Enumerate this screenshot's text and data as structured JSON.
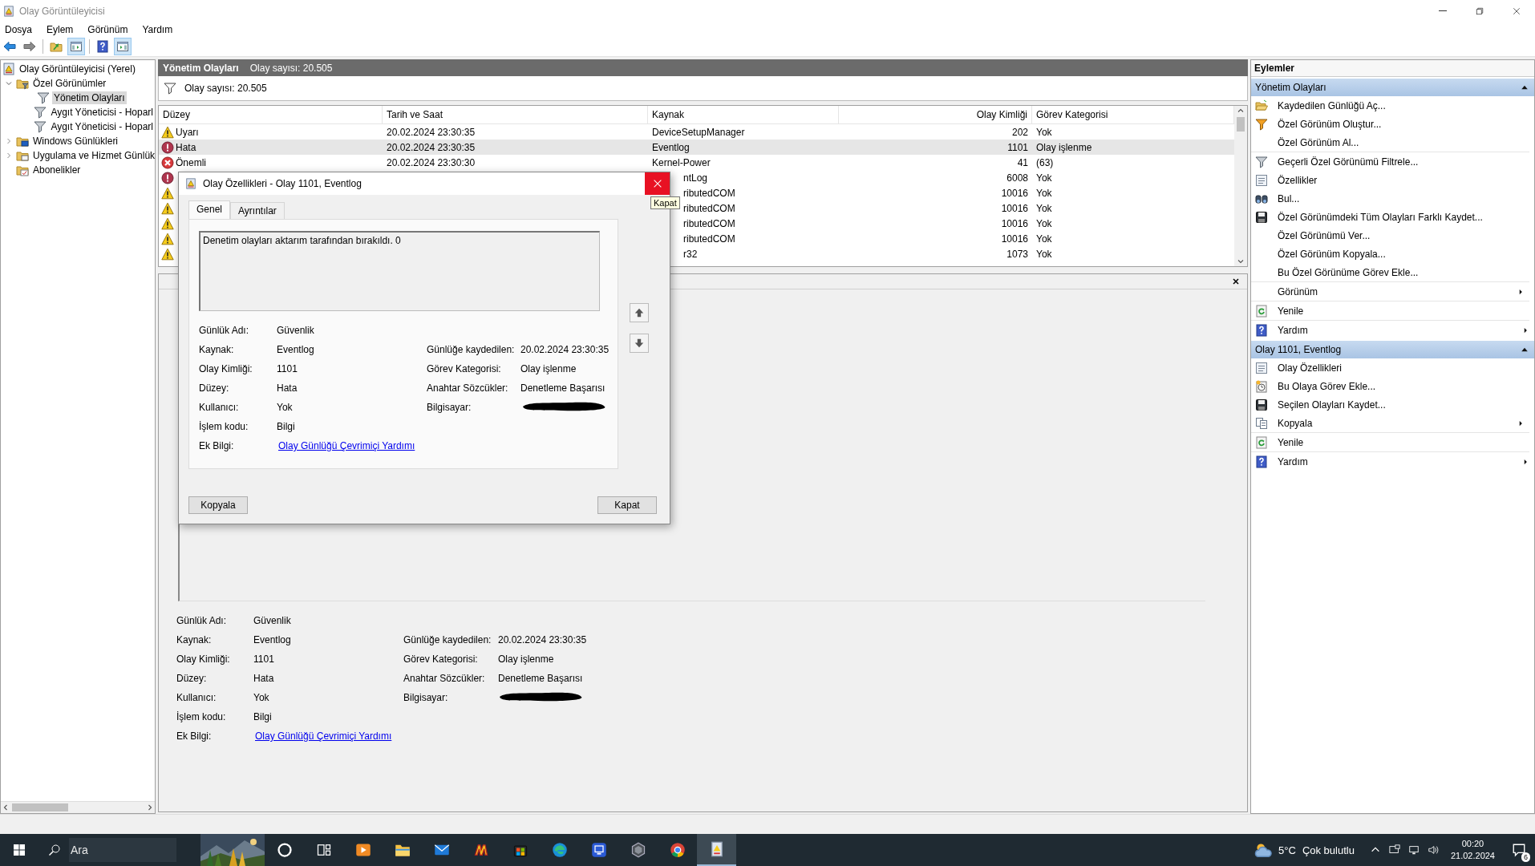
{
  "window": {
    "title": "Olay Görüntüleyicisi"
  },
  "menu": [
    "Dosya",
    "Eylem",
    "Görünüm",
    "Yardım"
  ],
  "toolbar": [
    {
      "kind": "back",
      "disabled": false
    },
    {
      "kind": "forward",
      "disabled": true
    },
    {
      "kind": "separator"
    },
    {
      "kind": "up-folder",
      "pressed": false
    },
    {
      "kind": "tree-pane",
      "pressed": true
    },
    {
      "kind": "separator"
    },
    {
      "kind": "help",
      "pressed": false
    },
    {
      "kind": "action-pane",
      "pressed": true
    }
  ],
  "tree": [
    {
      "label": "Olay Görüntüleyicisi (Yerel)",
      "kind": "viewer",
      "selected": false,
      "children": [
        {
          "label": "Özel Görünümler",
          "kind": "folder-filter",
          "expanded": true,
          "selected": false,
          "children": [
            {
              "label": "Yönetim Olayları",
              "kind": "filter",
              "selected": true
            },
            {
              "label": "Aygıt Yöneticisi - Hoparl",
              "kind": "filter",
              "selected": false
            },
            {
              "label": "Aygıt Yöneticisi - Hoparl",
              "kind": "filter",
              "selected": false
            }
          ]
        },
        {
          "label": "Windows Günlükleri",
          "kind": "folder-log",
          "expanded": false,
          "selected": false
        },
        {
          "label": "Uygulama ve Hizmet Günlük",
          "kind": "folder-app",
          "expanded": false,
          "selected": false
        },
        {
          "label": "Abonelikler",
          "kind": "subscriptions",
          "selected": false
        }
      ]
    }
  ],
  "header": {
    "title": "Yönetim Olayları",
    "count": "Olay sayısı: 20.505"
  },
  "filter_bar": {
    "text": "Olay sayısı: 20.505"
  },
  "table": {
    "columns": [
      "Düzey",
      "Tarih ve Saat",
      "Kaynak",
      "Olay Kimliği",
      "Görev Kategorisi"
    ],
    "rows": [
      {
        "kind": "warning",
        "level_text": "Uyarı",
        "date": "20.02.2024 23:30:35",
        "source": "DeviceSetupManager",
        "id": "202",
        "category": "Yok",
        "selected": false
      },
      {
        "kind": "error",
        "level_text": "Hata",
        "date": "20.02.2024 23:30:35",
        "source": "Eventlog",
        "id": "1101",
        "category": "Olay işlenme",
        "selected": true
      },
      {
        "kind": "critical",
        "level_text": "Önemli",
        "date": "20.02.2024 23:30:30",
        "source": "Kernel-Power",
        "id": "41",
        "category": "(63)",
        "selected": false
      },
      {
        "kind": "error",
        "source": "ntLog",
        "id": "6008",
        "category": "Yok",
        "selected": false
      },
      {
        "kind": "warning",
        "source": "ributedCOM",
        "id": "10016",
        "category": "Yok",
        "selected": false
      },
      {
        "kind": "warning",
        "source": "ributedCOM",
        "id": "10016",
        "category": "Yok",
        "selected": false
      },
      {
        "kind": "warning",
        "source": "ributedCOM",
        "id": "10016",
        "category": "Yok",
        "selected": false
      },
      {
        "kind": "warning",
        "source": "ributedCOM",
        "id": "10016",
        "category": "Yok",
        "selected": false
      },
      {
        "kind": "warning",
        "source": "r32",
        "id": "1073",
        "category": "Yok",
        "selected": false
      }
    ]
  },
  "details": {
    "fields": [
      {
        "left": {
          "label": "Günlük Adı:",
          "value": "Güvenlik"
        }
      },
      {
        "left": {
          "label": "Kaynak:",
          "value": "Eventlog"
        },
        "right": {
          "label": "Günlüğe kaydedilen:",
          "value": "20.02.2024 23:30:35"
        }
      },
      {
        "left": {
          "label": "Olay Kimliği:",
          "value": "1101"
        },
        "right": {
          "label": "Görev Kategorisi:",
          "value": "Olay işlenme"
        }
      },
      {
        "left": {
          "label": "Düzey:",
          "value": "Hata"
        },
        "right": {
          "label": "Anahtar Sözcükler:",
          "value": "Denetleme Başarısı"
        }
      },
      {
        "left": {
          "label": "Kullanıcı:",
          "value": "Yok"
        },
        "right": {
          "label": "Bilgisayar:",
          "redacted": true
        }
      },
      {
        "left": {
          "label": "İşlem kodu:",
          "value": "Bilgi"
        }
      },
      {
        "left": {
          "label": "Ek Bilgi:",
          "link": "Olay Günlüğü Çevrimiçi Yardımı"
        }
      }
    ]
  },
  "dialog": {
    "title": "Olay Özellikleri - Olay 1101, Eventlog",
    "close_tooltip": "Kapat",
    "tabs": [
      {
        "label": "Genel",
        "selected": true
      },
      {
        "label": "Ayrıntılar",
        "selected": false
      }
    ],
    "description": "Denetim olayları aktarım tarafından bırakıldı. 0",
    "fields": [
      {
        "left": {
          "label": "Günlük Adı:",
          "value": "Güvenlik"
        }
      },
      {
        "left": {
          "label": "Kaynak:",
          "value": "Eventlog"
        },
        "right": {
          "label": "Günlüğe kaydedilen:",
          "value": "20.02.2024 23:30:35"
        }
      },
      {
        "left": {
          "label": "Olay Kimliği:",
          "value": "1101"
        },
        "right": {
          "label": "Görev Kategorisi:",
          "value": "Olay işlenme"
        }
      },
      {
        "left": {
          "label": "Düzey:",
          "value": "Hata"
        },
        "right": {
          "label": "Anahtar Sözcükler:",
          "value": "Denetleme Başarısı"
        }
      },
      {
        "left": {
          "label": "Kullanıcı:",
          "value": "Yok"
        },
        "right": {
          "label": "Bilgisayar:",
          "redacted": true
        }
      },
      {
        "left": {
          "label": "İşlem kodu:",
          "value": "Bilgi"
        }
      },
      {
        "left": {
          "label": "Ek Bilgi:",
          "link": "Olay Günlüğü Çevrimiçi Yardımı"
        }
      }
    ],
    "buttons": [
      "Kopyala",
      "Kapat"
    ]
  },
  "actions": {
    "title": "Eylemler",
    "sections": [
      {
        "title": "Yönetim Olayları",
        "expanded": true,
        "items": [
          {
            "label": "Kaydedilen Günlüğü Aç...",
            "kind": "open",
            "submenu": false,
            "divider": false
          },
          {
            "label": "Özel Görünüm Oluştur...",
            "kind": "filter-color",
            "submenu": false,
            "divider": false
          },
          {
            "label": "Özel Görünüm Al...",
            "kind": "none",
            "submenu": false,
            "divider": true
          },
          {
            "label": "Geçerli Özel Görünümü Filtrele...",
            "kind": "filter",
            "submenu": false,
            "divider": false
          },
          {
            "label": "Özellikler",
            "kind": "properties",
            "submenu": false,
            "divider": false
          },
          {
            "label": "Bul...",
            "kind": "binoculars",
            "submenu": false,
            "divider": false
          },
          {
            "label": "Özel Görünümdeki Tüm Olayları Farklı Kaydet...",
            "kind": "save",
            "submenu": false,
            "divider": false
          },
          {
            "label": "Özel Görünümü Ver...",
            "kind": "none",
            "submenu": false,
            "divider": false
          },
          {
            "label": "Özel Görünüm Kopyala...",
            "kind": "none",
            "submenu": false,
            "divider": false
          },
          {
            "label": "Bu Özel Görünüme Görev Ekle...",
            "kind": "none",
            "submenu": false,
            "divider": true
          },
          {
            "label": "Görünüm",
            "kind": "none",
            "submenu": true,
            "divider": true
          },
          {
            "label": "Yenile",
            "kind": "refresh",
            "submenu": false,
            "divider": true
          },
          {
            "label": "Yardım",
            "kind": "help",
            "submenu": true,
            "divider": false
          }
        ]
      },
      {
        "title": "Olay 1101, Eventlog",
        "expanded": true,
        "items": [
          {
            "label": "Olay Özellikleri",
            "kind": "properties",
            "submenu": false,
            "divider": false
          },
          {
            "label": "Bu Olaya Görev Ekle...",
            "kind": "task",
            "submenu": false,
            "divider": false
          },
          {
            "label": "Seçilen Olayları Kaydet...",
            "kind": "save",
            "submenu": false,
            "divider": false
          },
          {
            "label": "Kopyala",
            "kind": "copy",
            "submenu": true,
            "divider": true
          },
          {
            "label": "Yenile",
            "kind": "refresh",
            "submenu": false,
            "divider": true
          },
          {
            "label": "Yardım",
            "kind": "help",
            "submenu": true,
            "divider": false
          }
        ]
      }
    ]
  },
  "taskbar": {
    "search_placeholder": "Ara",
    "apps": [
      {
        "kind": "cortana",
        "selected": false
      },
      {
        "kind": "task-view",
        "selected": false
      },
      {
        "kind": "media",
        "selected": false
      },
      {
        "kind": "explorer",
        "selected": false
      },
      {
        "kind": "mail",
        "selected": false
      },
      {
        "kind": "game",
        "selected": false
      },
      {
        "kind": "store",
        "selected": false
      },
      {
        "kind": "edge",
        "selected": false
      },
      {
        "kind": "remote",
        "selected": false
      },
      {
        "kind": "hex",
        "selected": false
      },
      {
        "kind": "chrome",
        "selected": false
      },
      {
        "kind": "event-viewer",
        "selected": true
      }
    ],
    "weather": {
      "temp": "5°C",
      "text": "Çok bulutlu"
    },
    "time": "00:20",
    "date": "21.02.2024",
    "notifications": "6"
  }
}
